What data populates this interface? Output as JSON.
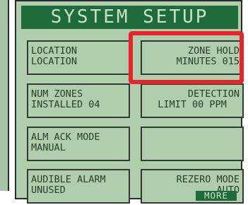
{
  "title": "SYSTEM SETUP",
  "buttons": {
    "location": {
      "line1": "LOCATION",
      "line2": "LOCATION"
    },
    "zone_hold": {
      "line1": "ZONE HOLD",
      "line2": "MINUTES 015"
    },
    "num_zones": {
      "line1": "NUM ZONES",
      "line2": "INSTALLED 04"
    },
    "detection_limit": {
      "line1": "DETECTION",
      "line2": "LIMIT 00 PPM"
    },
    "alm_ack_mode": {
      "line1": "ALM ACK MODE",
      "line2": "MANUAL"
    },
    "audible_alarm": {
      "line1": "AUDIBLE ALARM",
      "line2": "UNUSED"
    },
    "rezero_mode": {
      "line1": "REZERO MODE",
      "line2": "AUTO"
    }
  },
  "more_label": "MORE",
  "colors": {
    "screen_bg": "#b0cdae",
    "title_bg": "#1f6b3c",
    "title_text": "#c9e2c7",
    "button_text": "#2b3d2b",
    "highlight": "#e8232a"
  }
}
